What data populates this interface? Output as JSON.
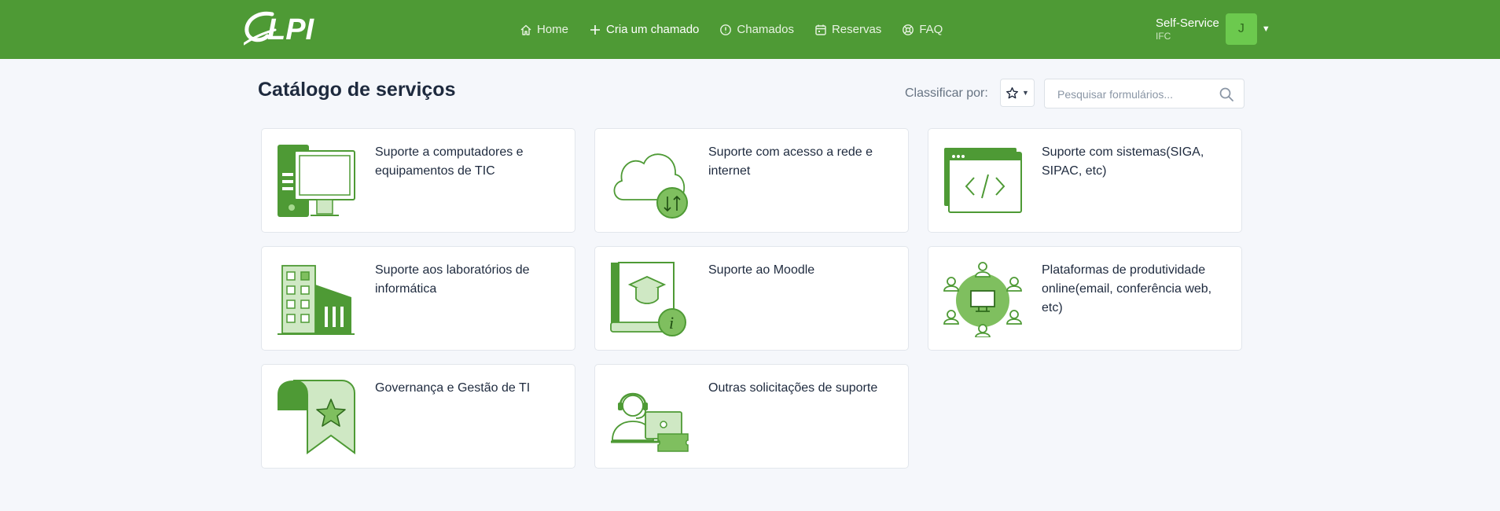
{
  "header": {
    "logo_text": "GLPI",
    "nav": [
      {
        "label": "Home",
        "icon": "home-icon"
      },
      {
        "label": "Cria um chamado",
        "icon": "plus-icon"
      },
      {
        "label": "Chamados",
        "icon": "alert-circle-icon"
      },
      {
        "label": "Reservas",
        "icon": "calendar-icon"
      },
      {
        "label": "FAQ",
        "icon": "lifebuoy-icon"
      }
    ],
    "profile": {
      "name": "Self-Service",
      "entity": "IFC",
      "avatar_initial": "J"
    }
  },
  "main": {
    "title": "Catálogo de serviços",
    "sort_label": "Classificar por:",
    "search_placeholder": "Pesquisar formulários...",
    "cards": [
      {
        "title": "Suporte a computadores e equipamentos de TIC",
        "icon": "computer-icon"
      },
      {
        "title": "Suporte com acesso a rede e internet",
        "icon": "cloud-network-icon"
      },
      {
        "title": "Suporte com sistemas(SIGA, SIPAC, etc)",
        "icon": "code-window-icon"
      },
      {
        "title": "Suporte aos laboratórios de informática",
        "icon": "building-icon"
      },
      {
        "title": "Suporte ao Moodle",
        "icon": "book-graduation-icon"
      },
      {
        "title": "Plataformas de produtividade online(email, conferência web, etc)",
        "icon": "network-people-icon"
      },
      {
        "title": "Governança e Gestão de TI",
        "icon": "ribbon-star-icon"
      },
      {
        "title": "Outras solicitações de suporte",
        "icon": "support-agent-icon"
      }
    ]
  },
  "colors": {
    "brand": "#4e9a35",
    "accent_light": "#cfe8c4",
    "avatar": "#6cc94e"
  }
}
